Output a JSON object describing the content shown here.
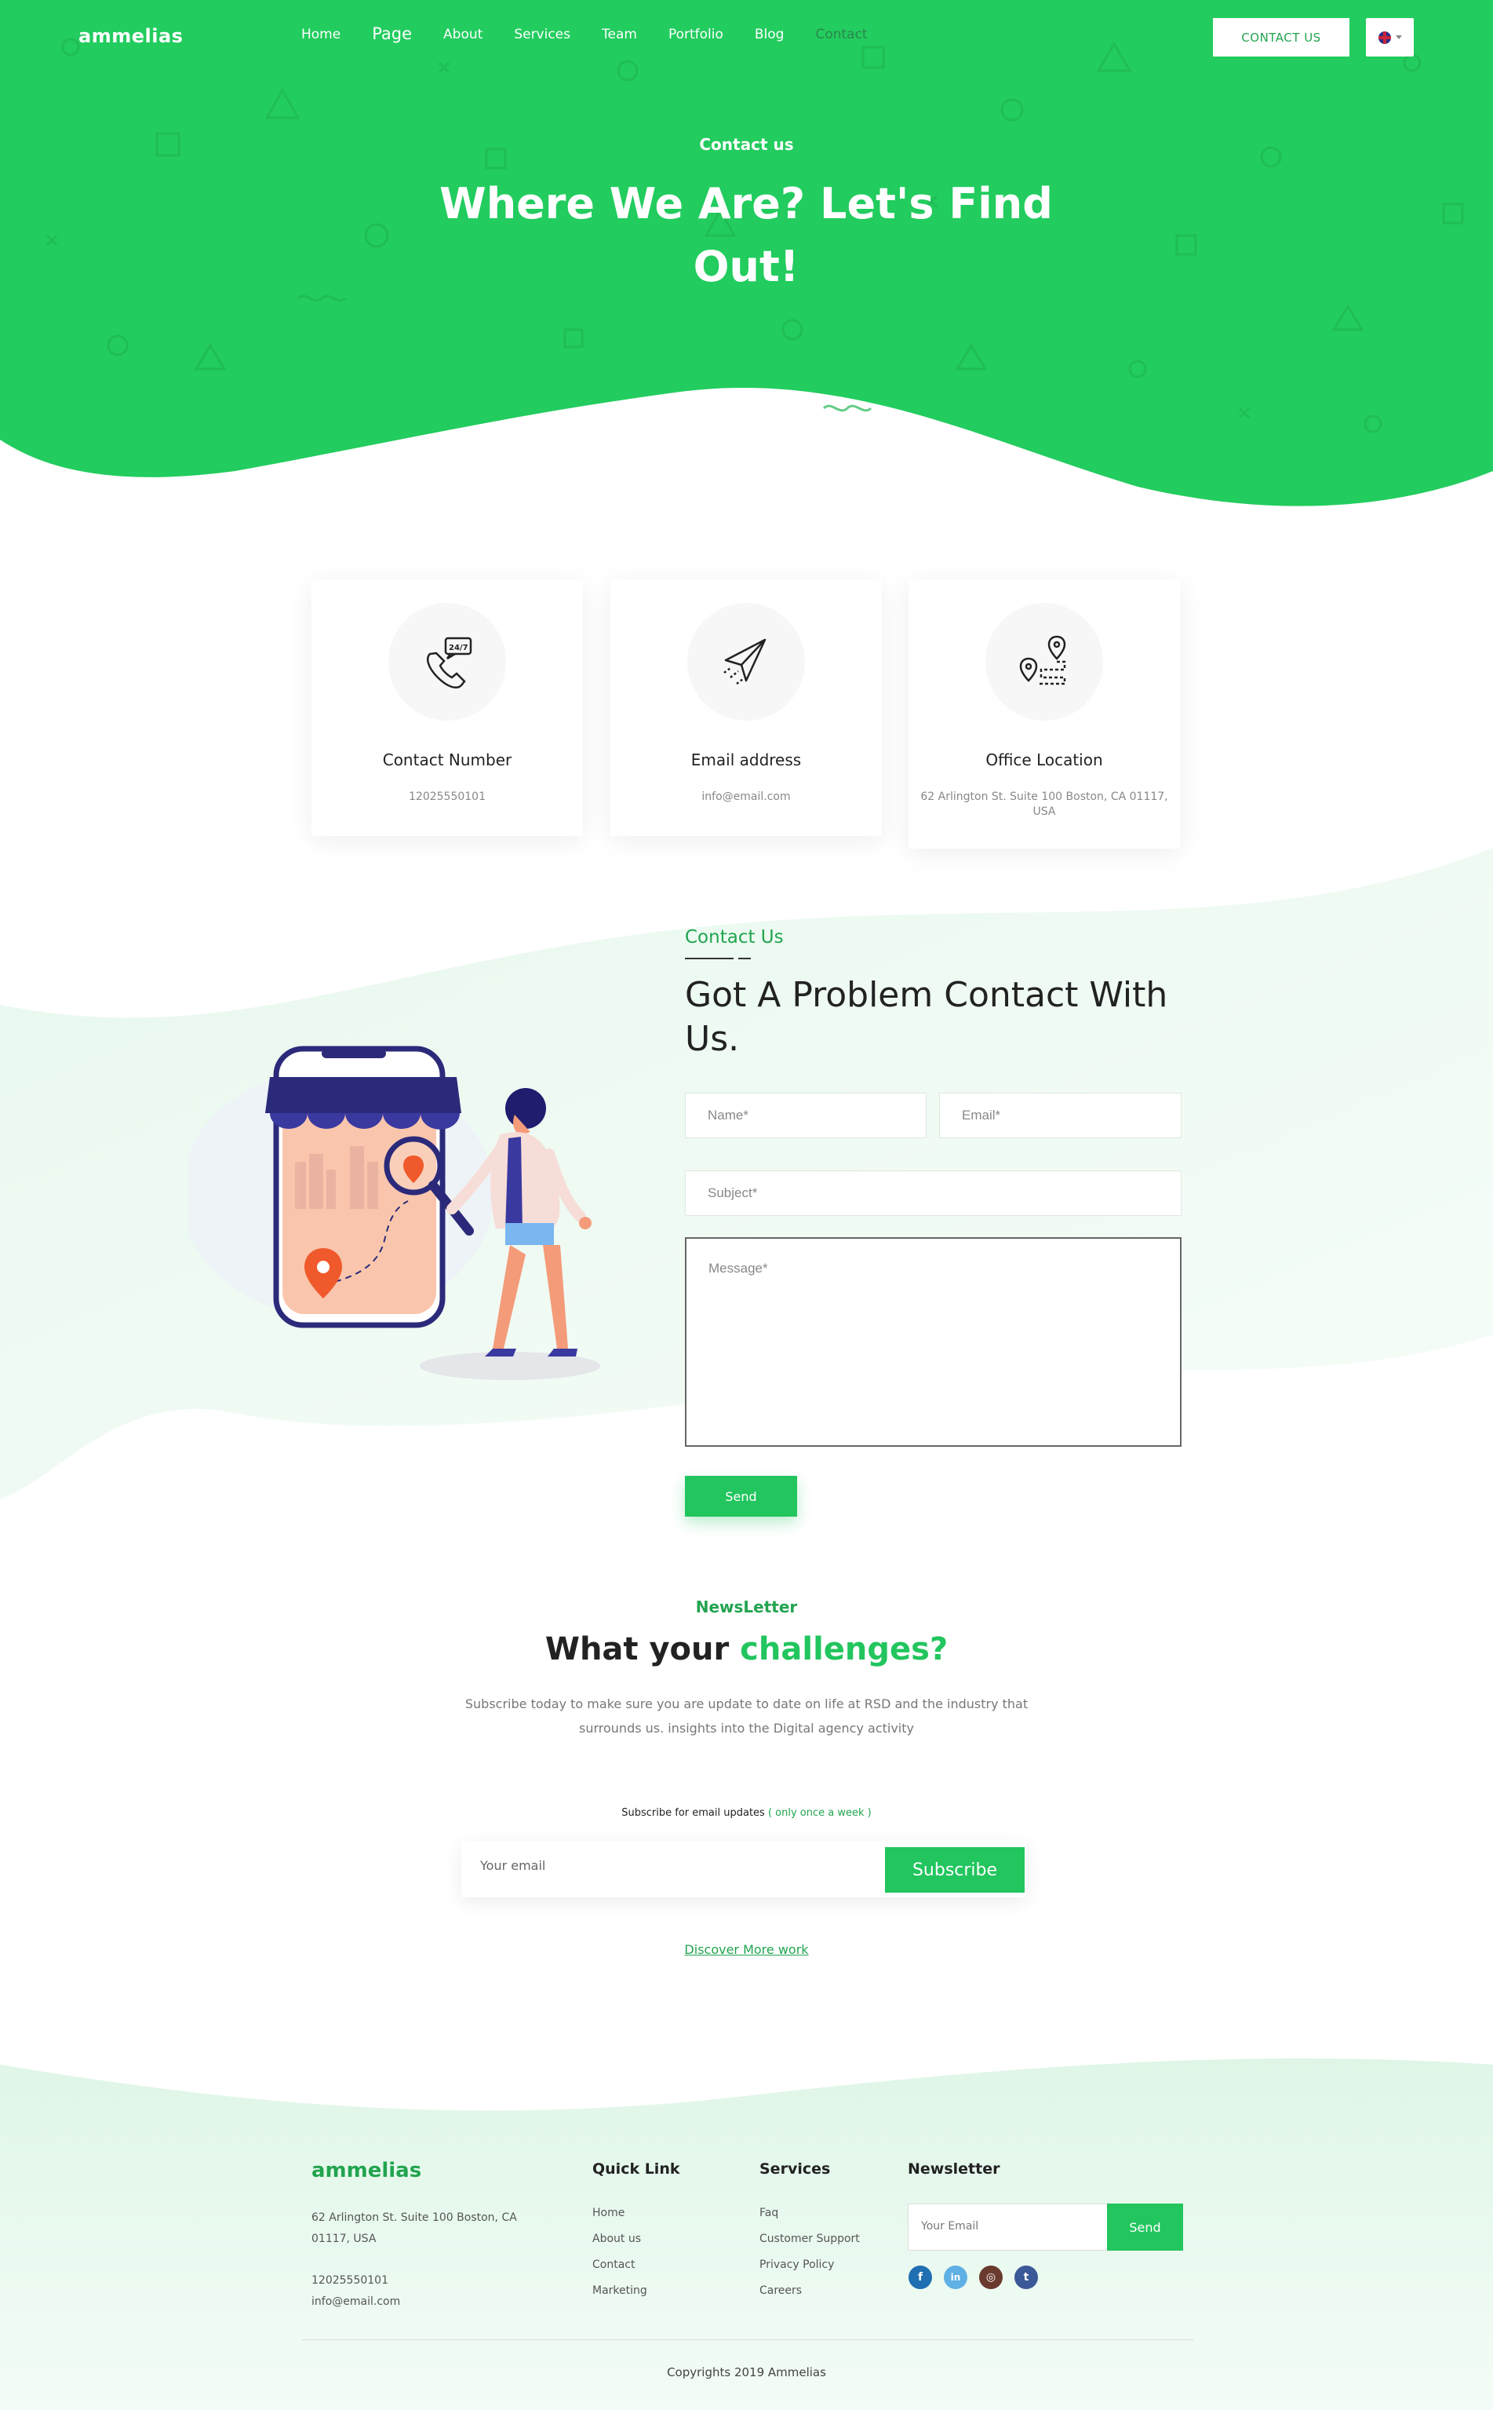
{
  "header": {
    "logo": "ammelias",
    "nav": [
      "Home",
      "Page",
      "About",
      "Services",
      "Team",
      "Portfolio",
      "Blog",
      "Contact"
    ],
    "contact_button": "CONTACT US"
  },
  "hero": {
    "subtitle": "Contact us",
    "title": "Where We Are? Let's Find Out!"
  },
  "cards": [
    {
      "icon": "phone-24-7-icon",
      "title": "Contact Number",
      "value": "12025550101"
    },
    {
      "icon": "paper-plane-icon",
      "title": "Email address",
      "value": "info@email.com"
    },
    {
      "icon": "location-route-icon",
      "title": "Office Location",
      "value": "62 Arlington St. Suite 100 Boston, CA 01117, USA"
    }
  ],
  "contact_form": {
    "label": "Contact Us",
    "title": "Got A Problem Contact With Us.",
    "name_placeholder": "Name*",
    "email_placeholder": "Email*",
    "subject_placeholder": "Subject*",
    "message_placeholder": "Message*",
    "send_label": "Send"
  },
  "newsletter": {
    "label": "NewsLetter",
    "title_plain": "What your",
    "title_highlight": "challenges?",
    "description": "Subscribe today to make sure you are update to date on life at RSD and the industry that surrounds us. insights into the Digital agency activity",
    "note_plain": "Subscribe for email updates",
    "note_highlight": "( only once a week )",
    "email_placeholder": "Your email",
    "subscribe_label": "Subscribe",
    "discover_link": "Discover More work"
  },
  "footer": {
    "logo": "ammelias",
    "address": "62 Arlington St. Suite 100 Boston, CA 01117, USA",
    "phone": "12025550101",
    "email": "info@email.com",
    "quick_link": {
      "title": "Quick Link",
      "items": [
        "Home",
        "About us",
        "Contact",
        "Marketing"
      ]
    },
    "services": {
      "title": "Services",
      "items": [
        "Faq",
        "Customer Support",
        "Privacy Policy",
        "Careers"
      ]
    },
    "newsletter": {
      "title": "Newsletter",
      "placeholder": "Your Email",
      "button": "Send"
    },
    "social": [
      {
        "icon": "facebook-icon",
        "glyph": "f",
        "color": "#1f6fb2"
      },
      {
        "icon": "linkedin-icon",
        "glyph": "in",
        "color": "#5fb0e4"
      },
      {
        "icon": "dribbble-icon",
        "glyph": "◎",
        "color": "#6b3a2e"
      },
      {
        "icon": "twitter-icon",
        "glyph": "t",
        "color": "#3b5998"
      }
    ],
    "copyright": "Copyrights 2019 Ammelias"
  },
  "colors": {
    "accent": "#22c55e",
    "accent_dark": "#22a44f",
    "hero": "#22cc5e"
  }
}
